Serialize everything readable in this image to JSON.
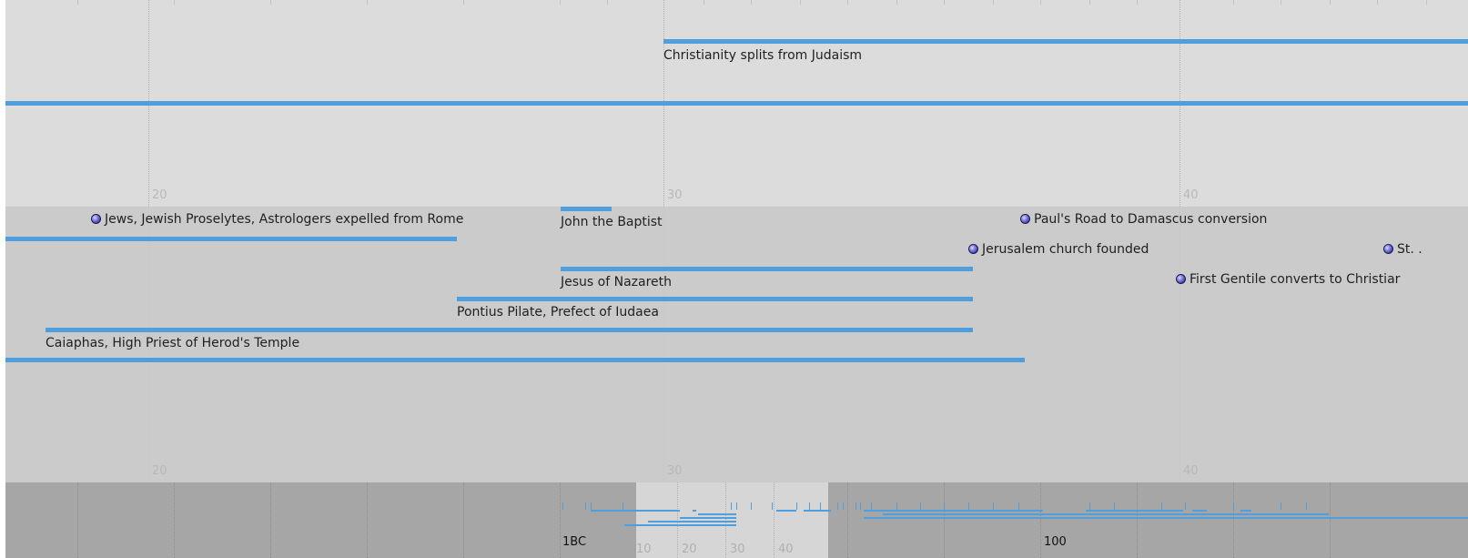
{
  "top_band": {
    "event_christianity": "Christianity splits from Judaism",
    "tick_labels": [
      "20",
      "30",
      "40"
    ]
  },
  "middle_band": {
    "events": {
      "jews_expelled": "Jews, Jewish Proselytes, Astrologers expelled from Rome",
      "john_baptist": "John the Baptist",
      "pauls_road": "Paul's Road to Damascus conversion",
      "jerusalem_church": "Jerusalem church founded",
      "st_partial": "St. .",
      "jesus": "Jesus of Nazareth",
      "first_gentile": "First Gentile converts to Christiar",
      "pontius": "Pontius Pilate, Prefect of Iudaea",
      "caiaphas": "Caiaphas, High Priest of Herod's Temple"
    },
    "tick_labels": [
      "20",
      "30",
      "40"
    ]
  },
  "overview_band": {
    "label_1bc": "1BC",
    "label_100": "100",
    "highlight_ticks": [
      "10",
      "20",
      "30",
      "40"
    ]
  },
  "colors": {
    "event_bar": "#4f9fdf",
    "top_band_bg": "#dcdcdc",
    "middle_band_bg": "#cbcbcb",
    "overview_band_bg": "#a6a6a6",
    "highlight_bg": "#d6d6d6"
  }
}
